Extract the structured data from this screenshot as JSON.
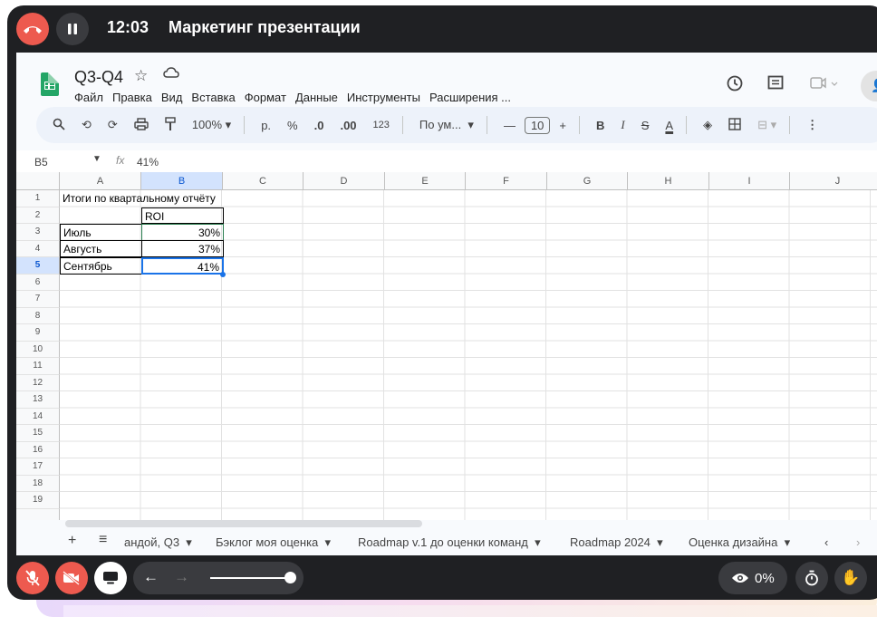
{
  "call": {
    "time": "12:03",
    "title": "Маркетинг презентации",
    "view_percent": "0%"
  },
  "doc": {
    "title": "Q3-Q4",
    "menu": [
      "Файл",
      "Правка",
      "Вид",
      "Вставка",
      "Формат",
      "Данные",
      "Инструменты",
      "Расширения ..."
    ]
  },
  "toolbar": {
    "zoom": "100%",
    "currency": "р.",
    "percent": "%",
    "dec_decrease": ".0",
    "dec_increase": ".00",
    "number_format": "123",
    "font": "По ум...",
    "font_size": "10",
    "bold": "B",
    "italic": "I",
    "strike": "S",
    "text_color": "A"
  },
  "formula_bar": {
    "cell_ref": "B5",
    "fx": "fx",
    "value": "41%"
  },
  "columns": [
    "A",
    "B",
    "C",
    "D",
    "E",
    "F",
    "G",
    "H",
    "I",
    "J"
  ],
  "rows": [
    "1",
    "2",
    "3",
    "4",
    "5",
    "6",
    "7",
    "8",
    "9",
    "10",
    "11",
    "12",
    "13",
    "14",
    "15",
    "16",
    "17",
    "18",
    "19"
  ],
  "cells": {
    "a1": "Итоги по квартальному отчёту",
    "b2": "ROI",
    "a3": "Июль",
    "b3": "30%",
    "a4": "Августь",
    "b4": "37%",
    "a5": "Сентябрь",
    "b5": "41%"
  },
  "sheet_tabs": [
    "андой, Q3",
    "Бэклог моя оценка",
    "Roadmap v.1 до оценки команд",
    "Roadmap 2024",
    "Оценка дизайна"
  ],
  "icons": {
    "hangup": "phone-hangup-icon",
    "pause": "pause-icon",
    "history": "history-icon",
    "comment": "comment-icon",
    "meet": "video-icon",
    "share": "add-person-icon"
  },
  "colors": {
    "hangup_red": "#ed5a4f",
    "sheets_green": "#23a566",
    "selection_blue": "#1a73e8",
    "call_bg": "#1f2023"
  }
}
